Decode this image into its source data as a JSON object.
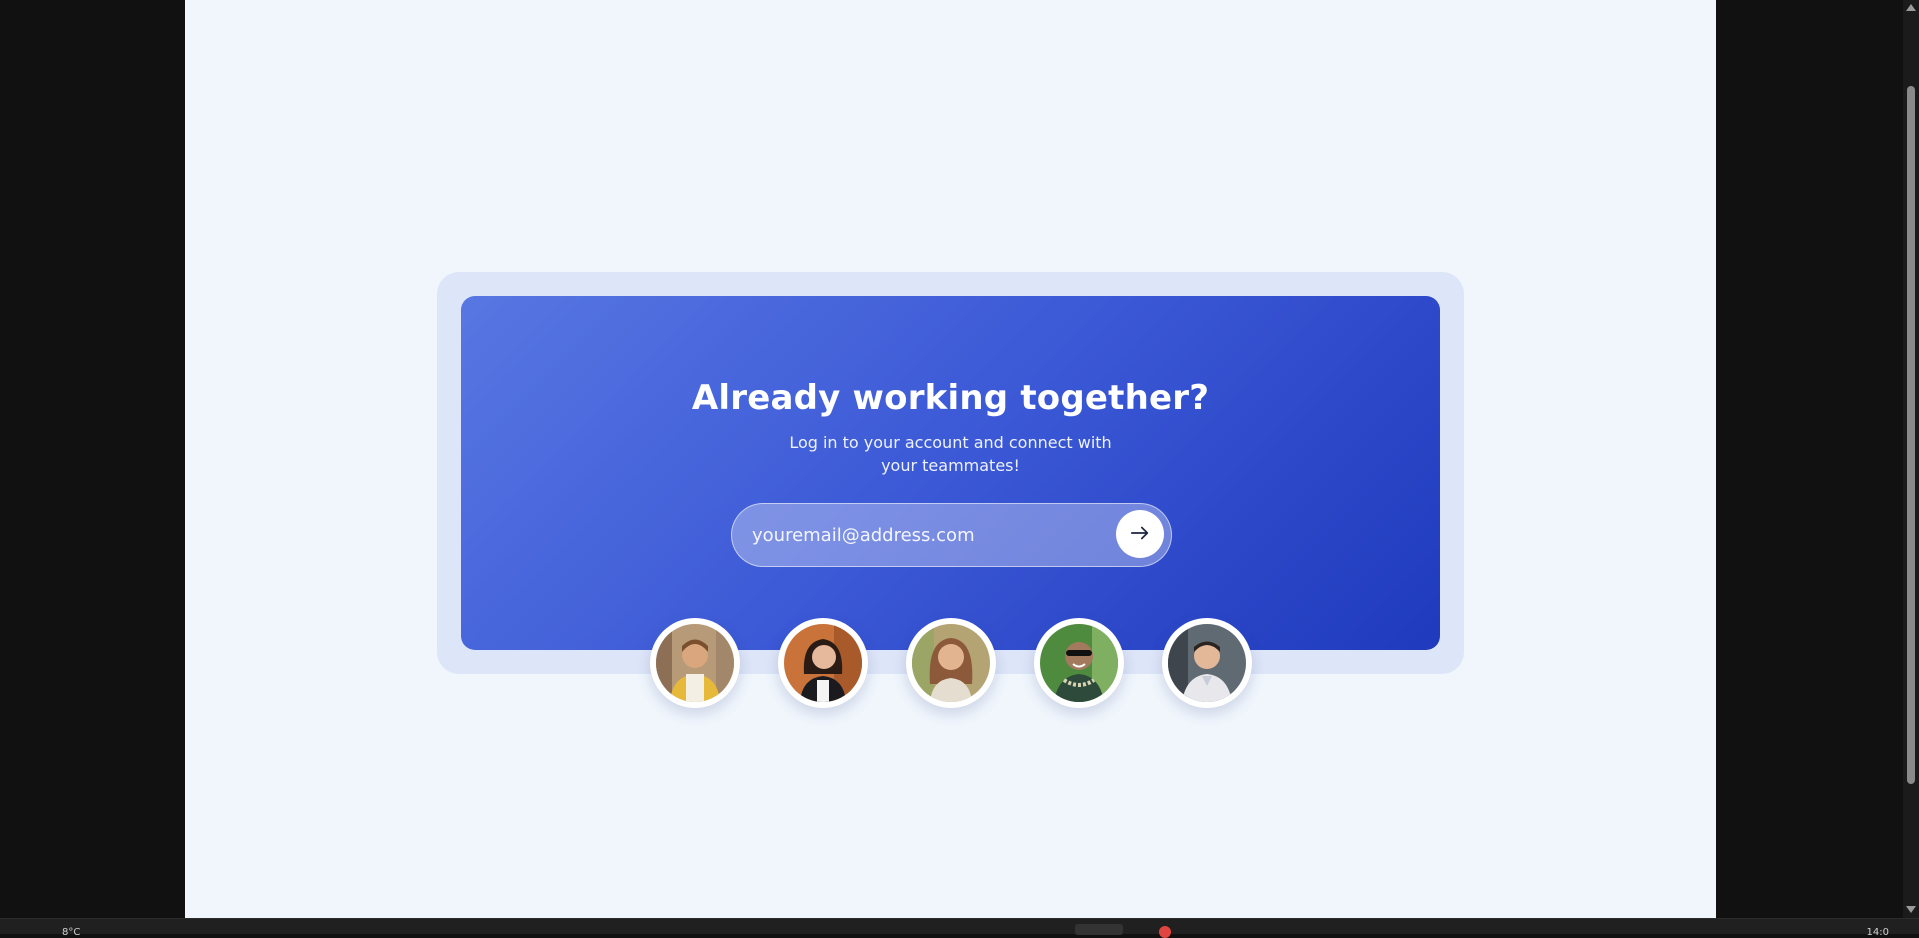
{
  "hero": {
    "title": "Already working together?",
    "subtitle": "Log in to your account and connect with your teammates!"
  },
  "email_form": {
    "placeholder": "youremail@address.com",
    "value": "",
    "submit_icon": "arrow-right-icon"
  },
  "team": {
    "avatars": [
      {
        "name": "avatar-1",
        "accent": "#e7b93b"
      },
      {
        "name": "avatar-2",
        "accent": "#c9733a"
      },
      {
        "name": "avatar-3",
        "accent": "#b4a373"
      },
      {
        "name": "avatar-4",
        "accent": "#4f8b3f"
      },
      {
        "name": "avatar-5",
        "accent": "#5f6a72"
      }
    ]
  },
  "taskbar": {
    "left_text": "8°C",
    "right_text": "14:0"
  },
  "colors": {
    "page_background": "#f1f6fd",
    "card_frame": "#dde5f8",
    "gradient_start": "#5877e2",
    "gradient_end": "#1f3abd"
  }
}
